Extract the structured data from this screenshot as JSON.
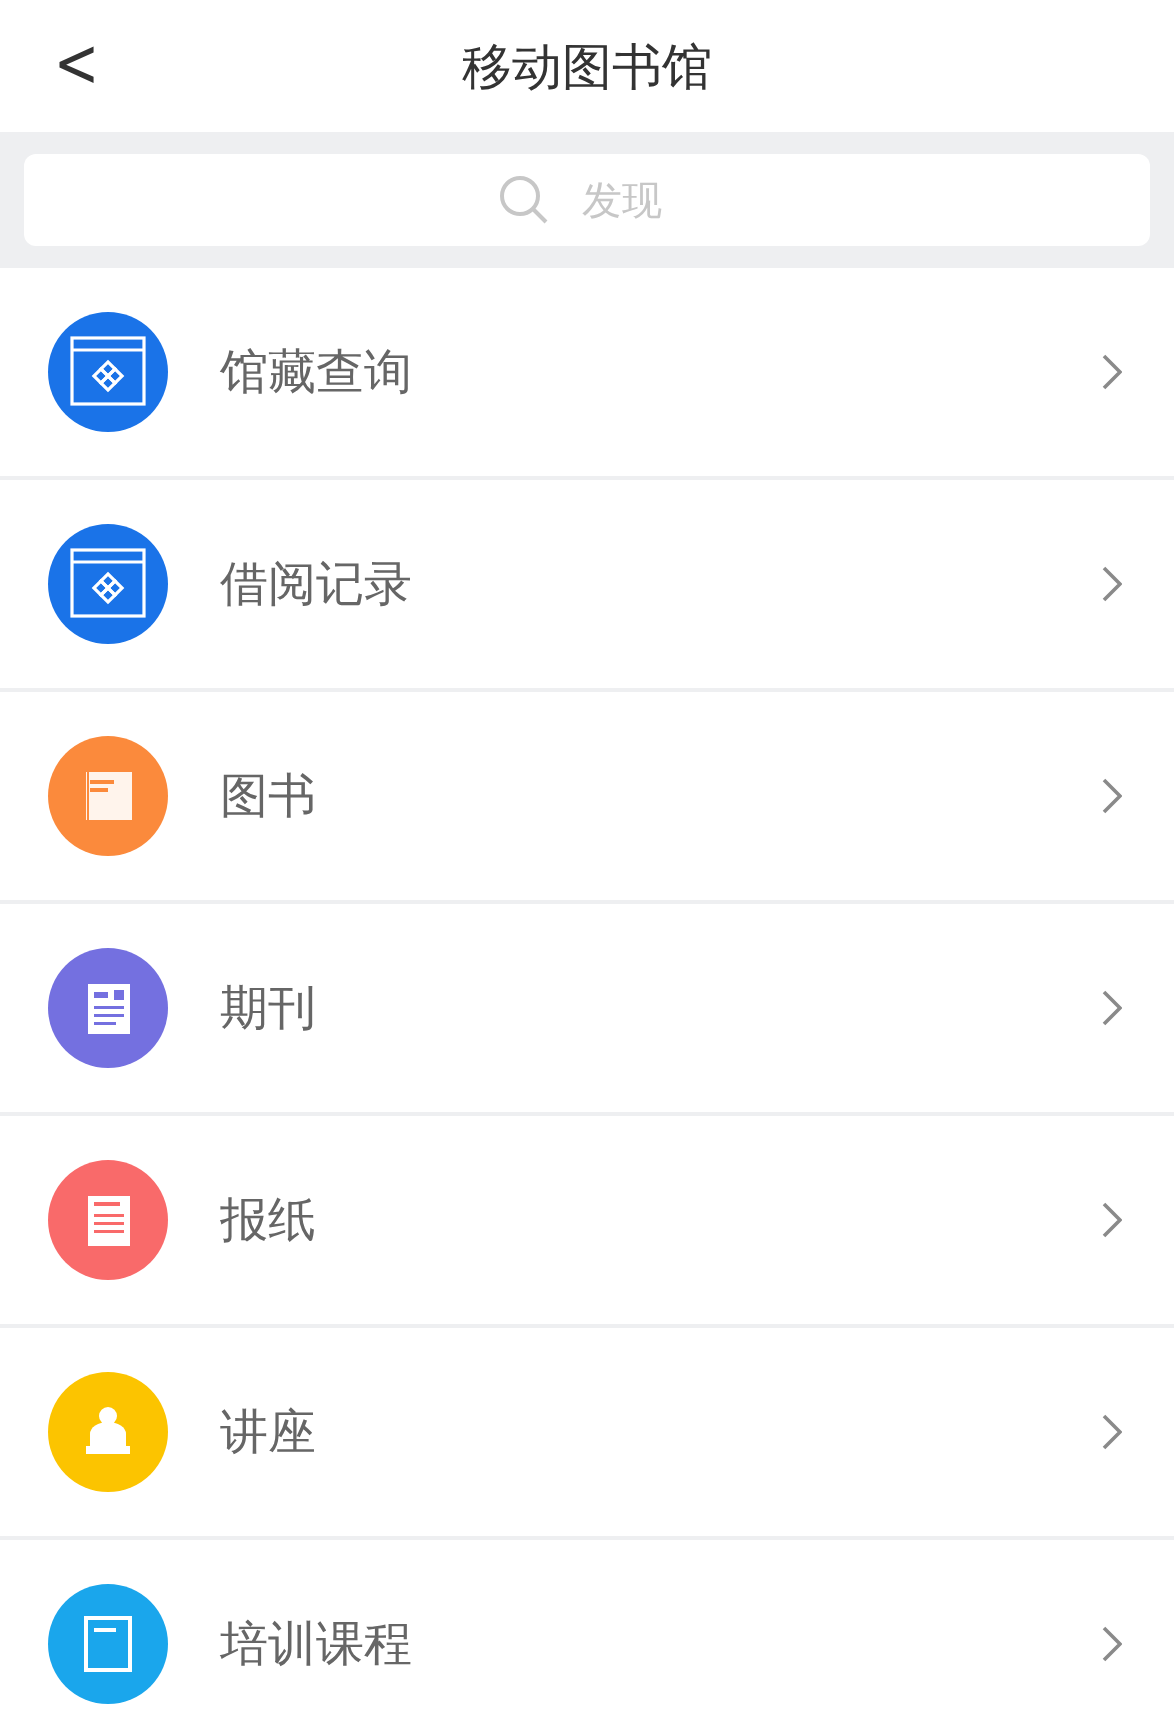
{
  "header": {
    "title": "移动图书馆",
    "back_icon": "<"
  },
  "search": {
    "placeholder": "发现"
  },
  "items": [
    {
      "label": "馆藏查询",
      "kind": "catalog",
      "color": "#1a73e8"
    },
    {
      "label": "借阅记录",
      "kind": "catalog",
      "color": "#1a73e8"
    },
    {
      "label": "图书",
      "kind": "book",
      "color": "#fb8a3c"
    },
    {
      "label": "期刊",
      "kind": "journal",
      "color": "#7470e0"
    },
    {
      "label": "报纸",
      "kind": "newspaper",
      "color": "#f96a6a"
    },
    {
      "label": "讲座",
      "kind": "lecture",
      "color": "#fcc400"
    },
    {
      "label": "培训课程",
      "kind": "course",
      "color": "#1aa6ec"
    }
  ]
}
